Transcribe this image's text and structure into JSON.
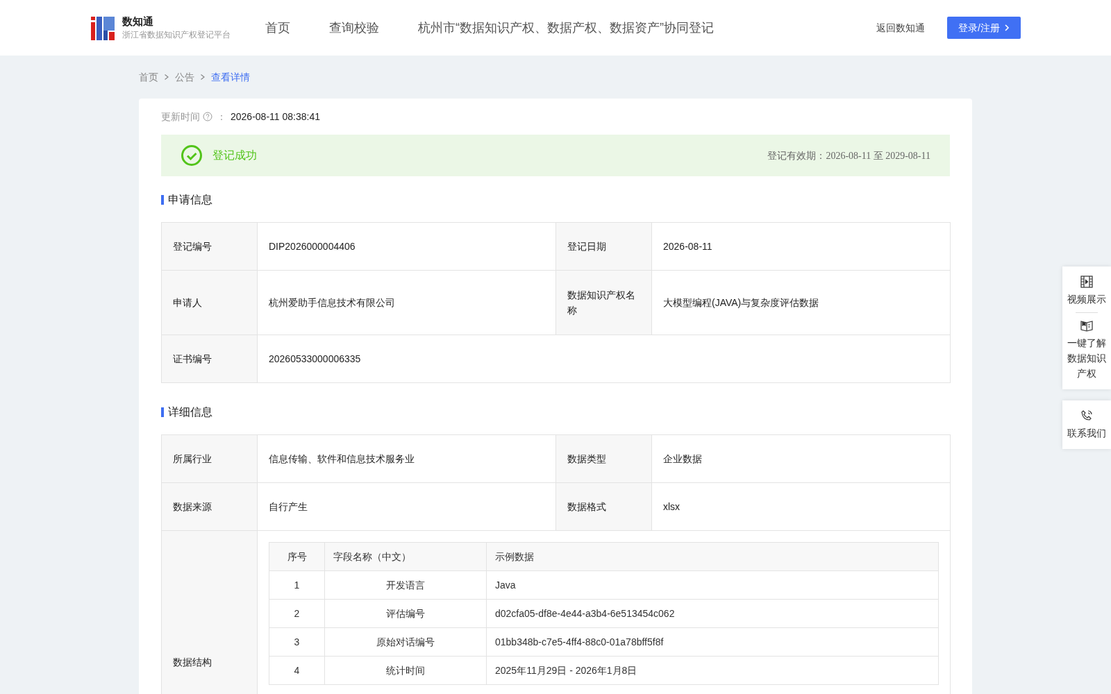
{
  "header": {
    "logo_name": "数知通",
    "logo_subtitle": "浙江省数据知识产权登记平台",
    "nav": [
      {
        "label": "首页",
        "selected": false
      },
      {
        "label": "查询校验",
        "selected": false
      },
      {
        "label": "杭州市“数据知识产权、数据产权、数据资产”协同登记",
        "selected": false
      }
    ],
    "back_link": "返回数知通",
    "login_button": "登录/注册"
  },
  "breadcrumb": [
    "首页",
    "公告",
    "查看详情"
  ],
  "update_time": {
    "label": "更新时间",
    "separator": "：",
    "value": "2026-08-11 08:38:41"
  },
  "status": {
    "kind": "success",
    "text": "登记成功",
    "validity": "登记有效期：2026-08-11 至 2029-08-11"
  },
  "sections": [
    {
      "title": "申请信息",
      "rows": [
        [
          {
            "label": "登记编号",
            "value": "DIP2026000004406"
          },
          {
            "label": "登记日期",
            "value": "2026-08-11"
          }
        ],
        [
          {
            "label": "申请人",
            "value": "杭州爱助手信息技术有限公司"
          },
          {
            "label": "数据知识产权名称",
            "value": "大模型编程(JAVA)与复杂度评估数据"
          }
        ],
        [
          {
            "label": "证书编号",
            "value": "20260533000006335"
          }
        ]
      ]
    },
    {
      "title": "详细信息",
      "rows": [
        [
          {
            "label": "所属行业",
            "value": "信息传输、软件和信息技术服务业"
          },
          {
            "label": "数据类型",
            "value": "企业数据"
          }
        ],
        [
          {
            "label": "数据来源",
            "value": "自行产生"
          },
          {
            "label": "数据格式",
            "value": "xlsx"
          }
        ]
      ],
      "structure": {
        "label": "数据结构",
        "columns": [
          "序号",
          "字段名称（中文）",
          "示例数据"
        ],
        "rows": [
          [
            "1",
            "开发语言",
            "Java"
          ],
          [
            "2",
            "评估编号",
            "d02cfa05-df8e-4e44-a3b4-6e513454c062"
          ],
          [
            "3",
            "原始对话编号",
            "01bb348b-c7e5-4ff4-88c0-01a78bff5f8f"
          ],
          [
            "4",
            "统计时间",
            "2025年11月29日 - 2026年1月8日"
          ]
        ]
      }
    }
  ],
  "side_tools": [
    {
      "kind": "video",
      "label": "视频展示"
    },
    {
      "kind": "book",
      "label": "一键了解数据知识产权"
    },
    {
      "kind": "phone",
      "label": "联系我们"
    }
  ]
}
